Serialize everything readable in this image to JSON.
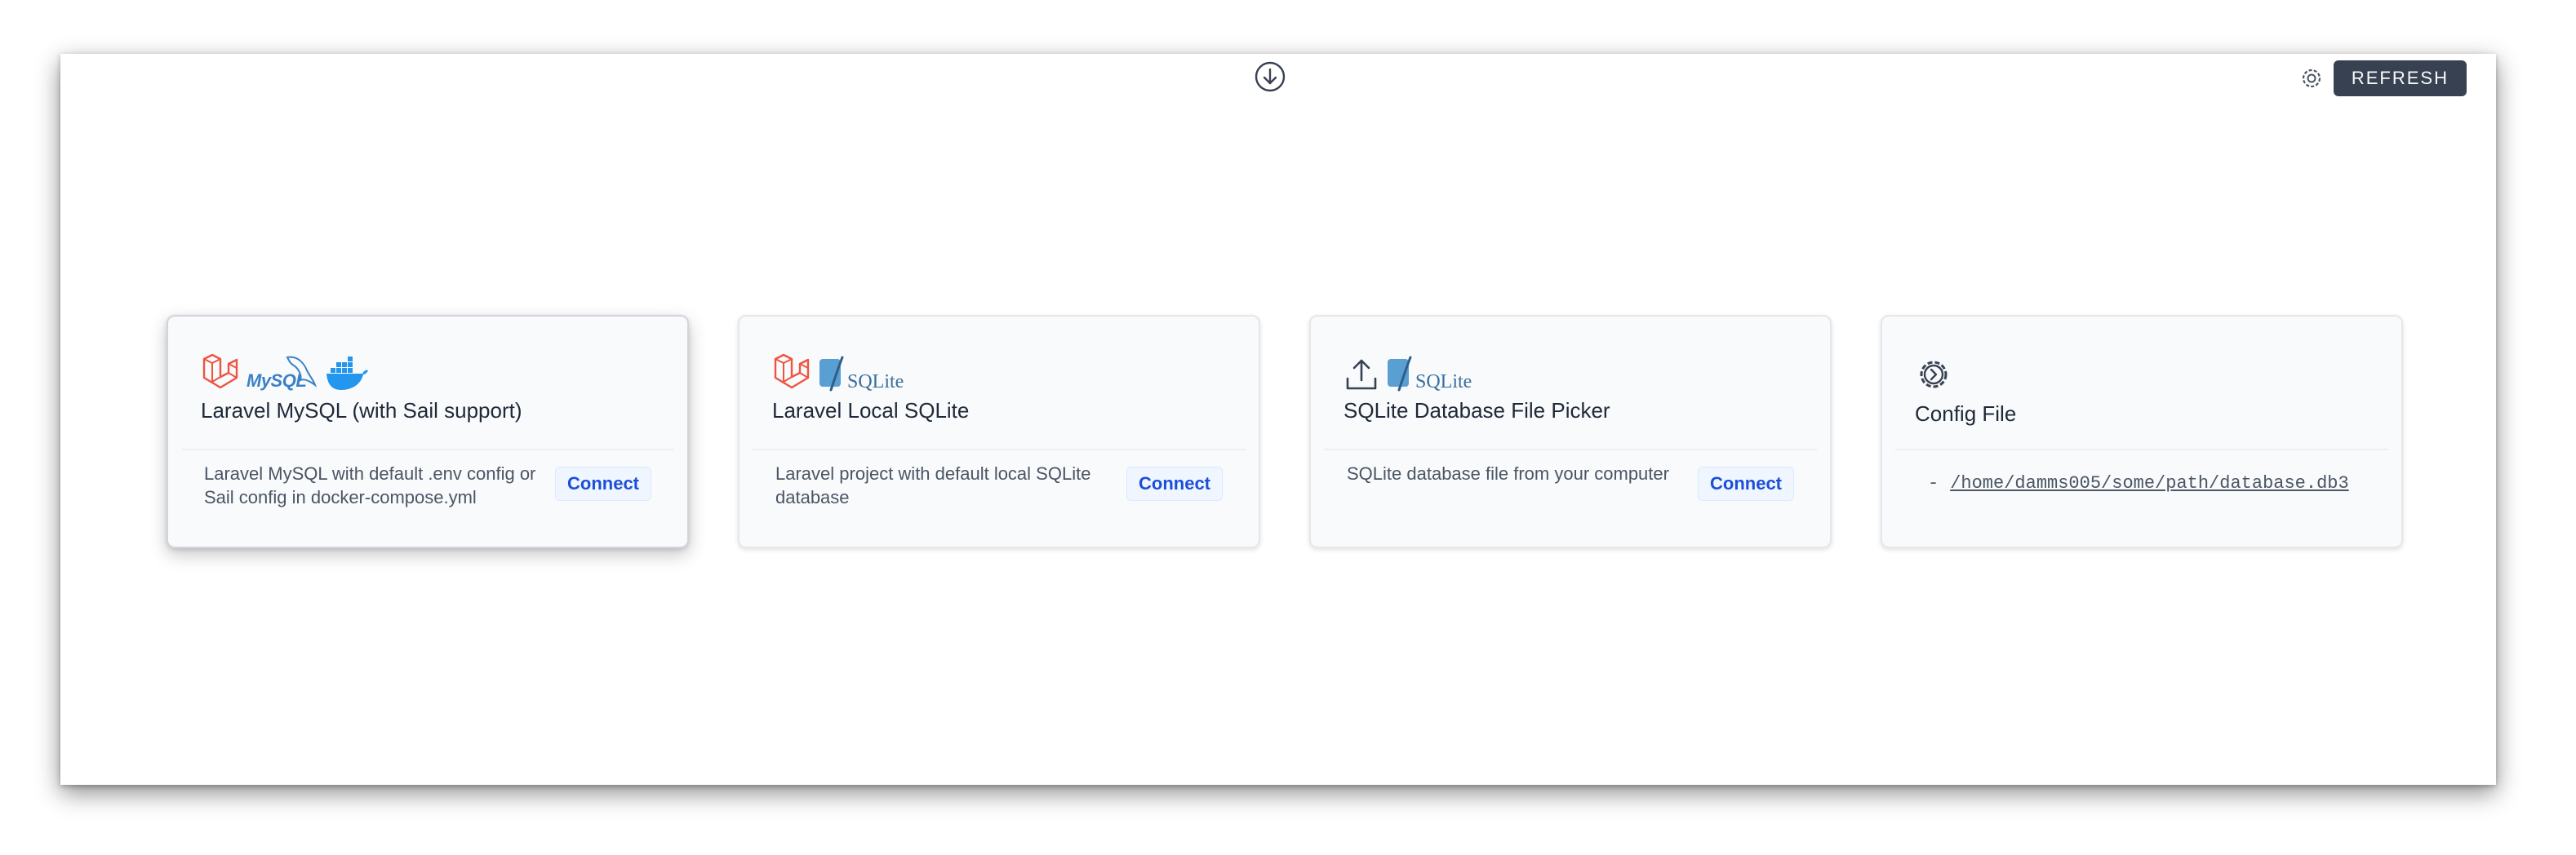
{
  "toolbar": {
    "download_icon": "download-circle-icon",
    "settings_icon": "gear-icon",
    "refresh_label": "REFRESH"
  },
  "cards": [
    {
      "title": "Laravel MySQL (with Sail support)",
      "description": "Laravel MySQL with default .env config or Sail config in docker-compose.yml",
      "button": "Connect",
      "icons": [
        "laravel-logo",
        "mysql-logo",
        "docker-logo"
      ],
      "logo_text": "MySQL"
    },
    {
      "title": "Laravel Local SQLite",
      "description": "Laravel project with default local SQLite database",
      "button": "Connect",
      "icons": [
        "laravel-logo",
        "sqlite-logo"
      ],
      "logo_text": "SQLite"
    },
    {
      "title": "SQLite Database File Picker",
      "description": "SQLite database file from your computer",
      "button": "Connect",
      "icons": [
        "upload-icon",
        "sqlite-logo"
      ],
      "logo_text": "SQLite"
    },
    {
      "title": "Config File",
      "icons": [
        "config-gear-icon"
      ],
      "paths": [
        "/home/damms005/some/path/database.db3"
      ]
    }
  ],
  "colors": {
    "refresh_bg": "#374151",
    "connect_text": "#1d4ed8",
    "laravel_red": "#f05340",
    "docker_blue": "#2496ed"
  }
}
